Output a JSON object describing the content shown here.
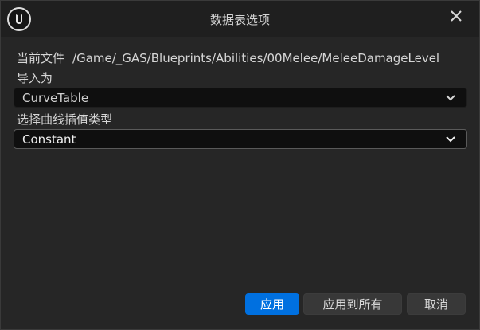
{
  "window": {
    "title": "数据表选项"
  },
  "current_file": {
    "label": "当前文件",
    "path": "/Game/_GAS/Blueprints/Abilities/00Melee/MeleeDamageLevel"
  },
  "import_as": {
    "label": "导入为",
    "value": "CurveTable"
  },
  "interpolation": {
    "label": "选择曲线插值类型",
    "value": "Constant"
  },
  "buttons": {
    "apply": "应用",
    "apply_all": "应用到所有",
    "cancel": "取消"
  },
  "colors": {
    "accent": "#0070e0",
    "background": "#262626",
    "titlebar": "#1f1f1f"
  }
}
